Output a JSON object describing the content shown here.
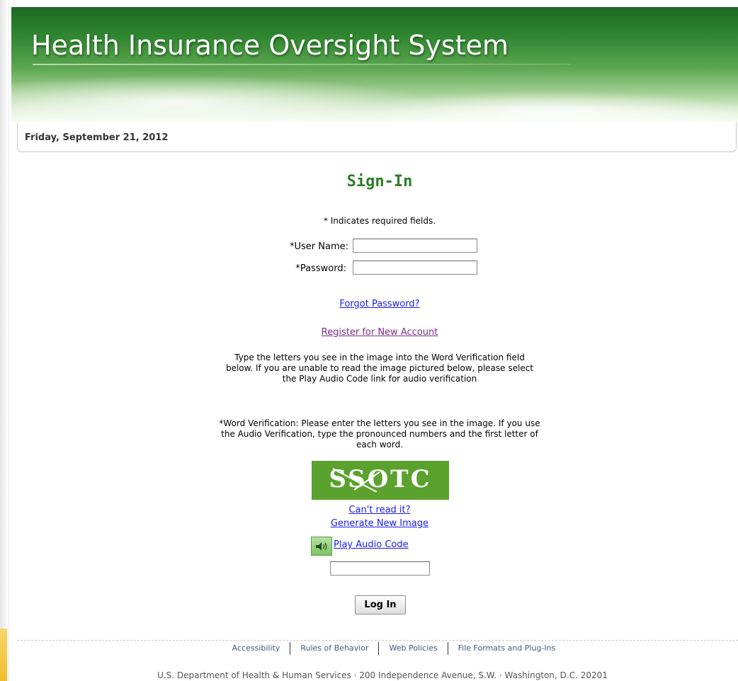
{
  "header": {
    "title": "Health Insurance Oversight System"
  },
  "date_bar": {
    "date": "Friday, September 21, 2012"
  },
  "signin": {
    "title": "Sign-In",
    "required_note": "* Indicates required fields.",
    "username_label": "*User Name:",
    "username_value": "",
    "password_label": "*Password:",
    "password_value": "",
    "forgot_password": "Forgot Password?",
    "register": "Register for New Account",
    "instructions": "Type the letters you see in the image into the Word Verification field below. If you are unable to read the image pictured below, please select the Play Audio Code link for audio verification",
    "word_verification_note": "*Word Verification: Please enter the letters you see in the image. If you use the Audio Verification, type the pronounced numbers and the first letter of each word.",
    "captcha_text": "SSOTC",
    "cant_read": "Can't read it?",
    "generate_new": "Generate New Image",
    "play_audio": "Play Audio Code",
    "verification_value": "",
    "login_button": "Log In"
  },
  "footer": {
    "links": [
      "Accessibility",
      "Rules of Behavior",
      "Web Policies",
      "File Formats and Plug-Ins"
    ],
    "address": "U.S. Department of Health & Human Services · 200 Independence Avenue, S.W. · Washington, D.C. 20201"
  },
  "colors": {
    "banner_green": "#2f8530",
    "title_green": "#2e7d28",
    "link_blue": "#1a1aee",
    "visited_purple": "#7b2a8a",
    "captcha_green": "#5aa12d"
  },
  "icons": {
    "audio": "speaker-icon"
  }
}
